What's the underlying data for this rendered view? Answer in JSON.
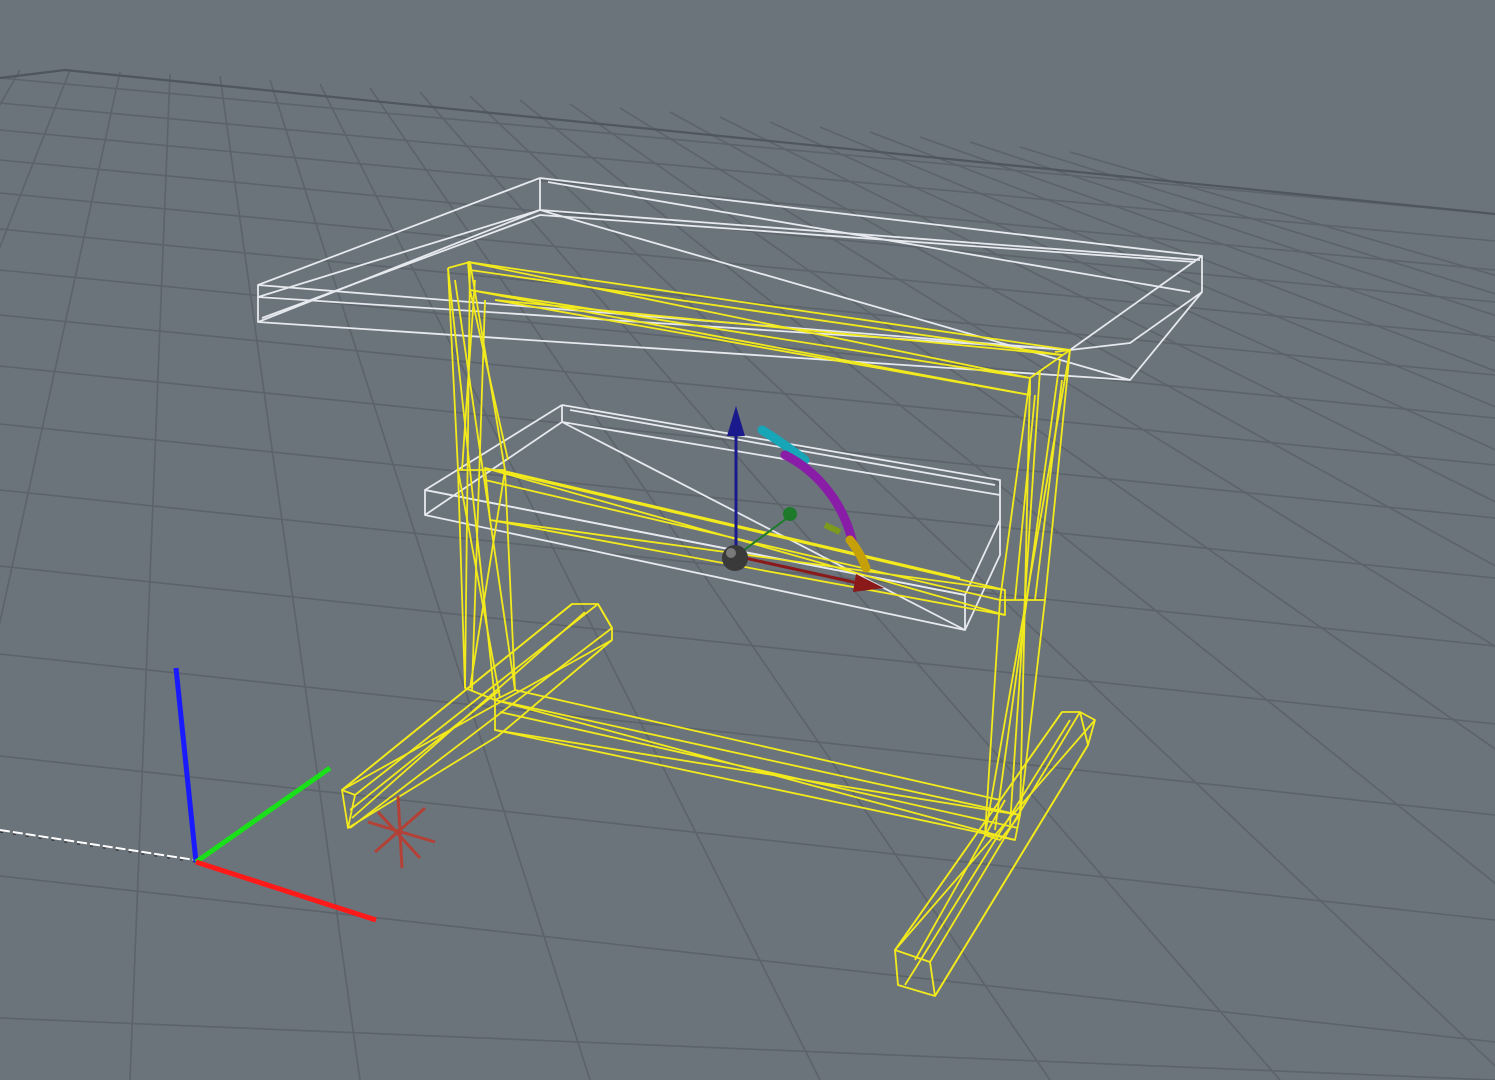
{
  "viewport": {
    "view": "perspective",
    "background_color": "#6b737b",
    "grid": {
      "visible": true,
      "color": "#5c636a",
      "border_color": "#4f565d"
    }
  },
  "scene": {
    "object_type": "desk-wireframe",
    "selected_parts_color": "#f2ea1c",
    "unselected_parts_color": "#e6e9ee",
    "parts": [
      {
        "name": "desktop",
        "selected": false
      },
      {
        "name": "shelf",
        "selected": false
      },
      {
        "name": "left-leg",
        "selected": true
      },
      {
        "name": "right-leg",
        "selected": true
      },
      {
        "name": "top-rail",
        "selected": true
      },
      {
        "name": "shelf-rail",
        "selected": true
      },
      {
        "name": "bottom-rail",
        "selected": true
      },
      {
        "name": "left-foot",
        "selected": true
      },
      {
        "name": "right-foot",
        "selected": true
      }
    ]
  },
  "manipulator": {
    "type": "move-rotate",
    "x_axis_color": "#8a1a1a",
    "y_axis_color": "#1d7a2a",
    "z_axis_color": "#1a1a8c",
    "rotate_arc_colors": [
      "#17a5b8",
      "#8a1da8",
      "#c5a008"
    ],
    "pivot_color": "#3a3a3a"
  },
  "world_axes": {
    "x_color": "#ff1a1a",
    "y_color": "#19e019",
    "z_color": "#1a1aff",
    "ground_line_color": "#ffffff"
  },
  "origin_marker": {
    "icon": "asterisk-origin",
    "color": "#c0392b"
  }
}
